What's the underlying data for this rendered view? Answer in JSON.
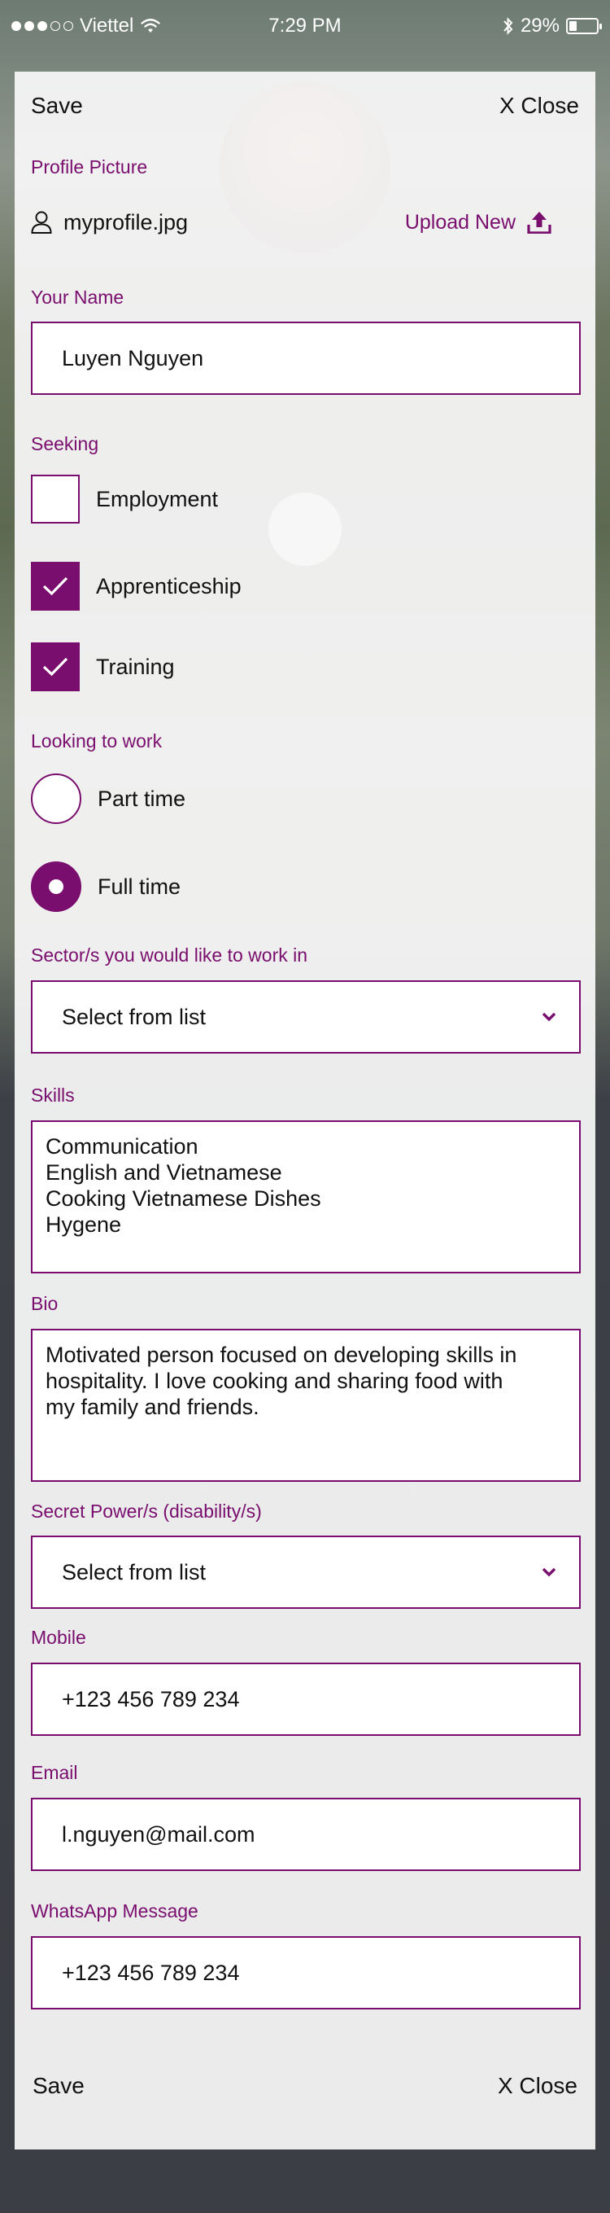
{
  "status": {
    "carrier": "Viettel",
    "time": "7:29 PM",
    "battery": "29%",
    "battery_level": 0.29
  },
  "topbar": {
    "save_label": "Save",
    "close_label": "X Close"
  },
  "profile_picture": {
    "label": "Profile Picture",
    "file_name": "myprofile.jpg",
    "upload_label": "Upload New"
  },
  "name": {
    "label": "Your Name",
    "value": "Luyen Nguyen"
  },
  "seeking": {
    "label": "Seeking",
    "options": [
      {
        "label": "Employment",
        "checked": false
      },
      {
        "label": "Apprenticeship",
        "checked": true
      },
      {
        "label": "Training",
        "checked": true
      }
    ]
  },
  "looking_to_work": {
    "label": "Looking to work",
    "options": [
      {
        "label": "Part time",
        "selected": false
      },
      {
        "label": "Full time",
        "selected": true
      }
    ]
  },
  "sector": {
    "label": "Sector/s you would like to work in",
    "value": "Select from list"
  },
  "skills": {
    "label": "Skills",
    "lines": [
      "Communication",
      "English and Vietnamese",
      "Cooking Vietnamese Dishes",
      "Hygene"
    ]
  },
  "bio": {
    "label": "Bio",
    "lines": [
      "Motivated person focused on developing skills in",
      "hospitality. I love cooking and sharing food with",
      "my family and friends."
    ]
  },
  "secret_power": {
    "label": "Secret Power/s (disability/s)",
    "value": "Select from list"
  },
  "mobile": {
    "label": "Mobile",
    "value": "+123 456 789 234"
  },
  "email": {
    "label": "Email",
    "value": "l.nguyen@mail.com"
  },
  "whatsapp": {
    "label": "WhatsApp Message",
    "value": "+123 456 789 234"
  },
  "bottombar": {
    "save_label": "Save",
    "close_label": "X Close"
  },
  "colors": {
    "accent": "#7a0e6e",
    "overlay": "#f7f7f7"
  },
  "icons": {
    "user": "user-icon",
    "upload": "upload-icon",
    "check": "check-icon",
    "chevron": "chevron-down-icon"
  }
}
